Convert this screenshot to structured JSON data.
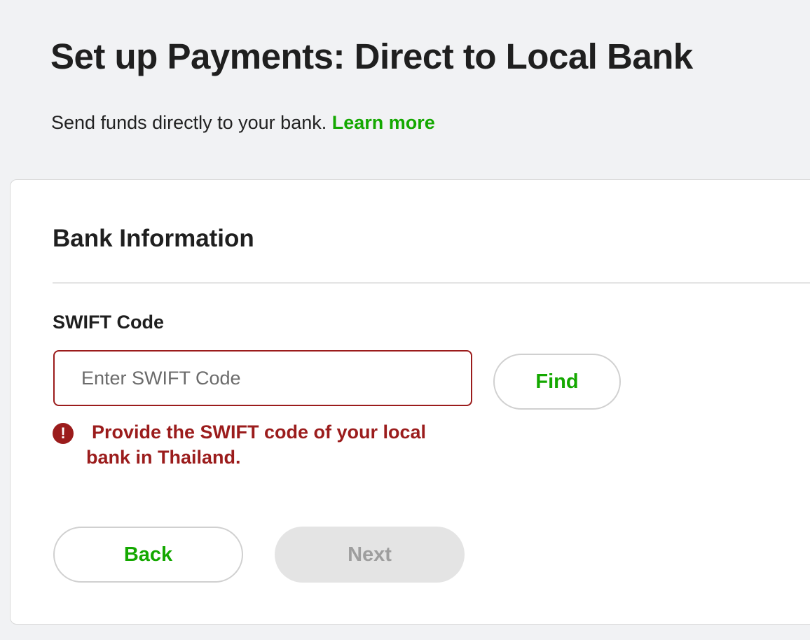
{
  "header": {
    "title": "Set up Payments: Direct to Local Bank",
    "subtitle": "Send funds directly to your bank.",
    "learn_more": "Learn more"
  },
  "bank_info": {
    "section_title": "Bank Information",
    "swift_label": "SWIFT Code",
    "swift_value": "",
    "swift_placeholder": "Enter SWIFT Code",
    "find_label": "Find",
    "error_icon_glyph": "!",
    "error_message": "Provide the SWIFT code of your local bank in Thailand."
  },
  "actions": {
    "back_label": "Back",
    "next_label": "Next",
    "next_disabled": true
  },
  "colors": {
    "accent": "#14a800",
    "error": "#9b1c1c",
    "background": "#f1f2f4",
    "disabled": "#e4e4e4"
  },
  "icons": {
    "error": "exclamation-circle-icon"
  }
}
